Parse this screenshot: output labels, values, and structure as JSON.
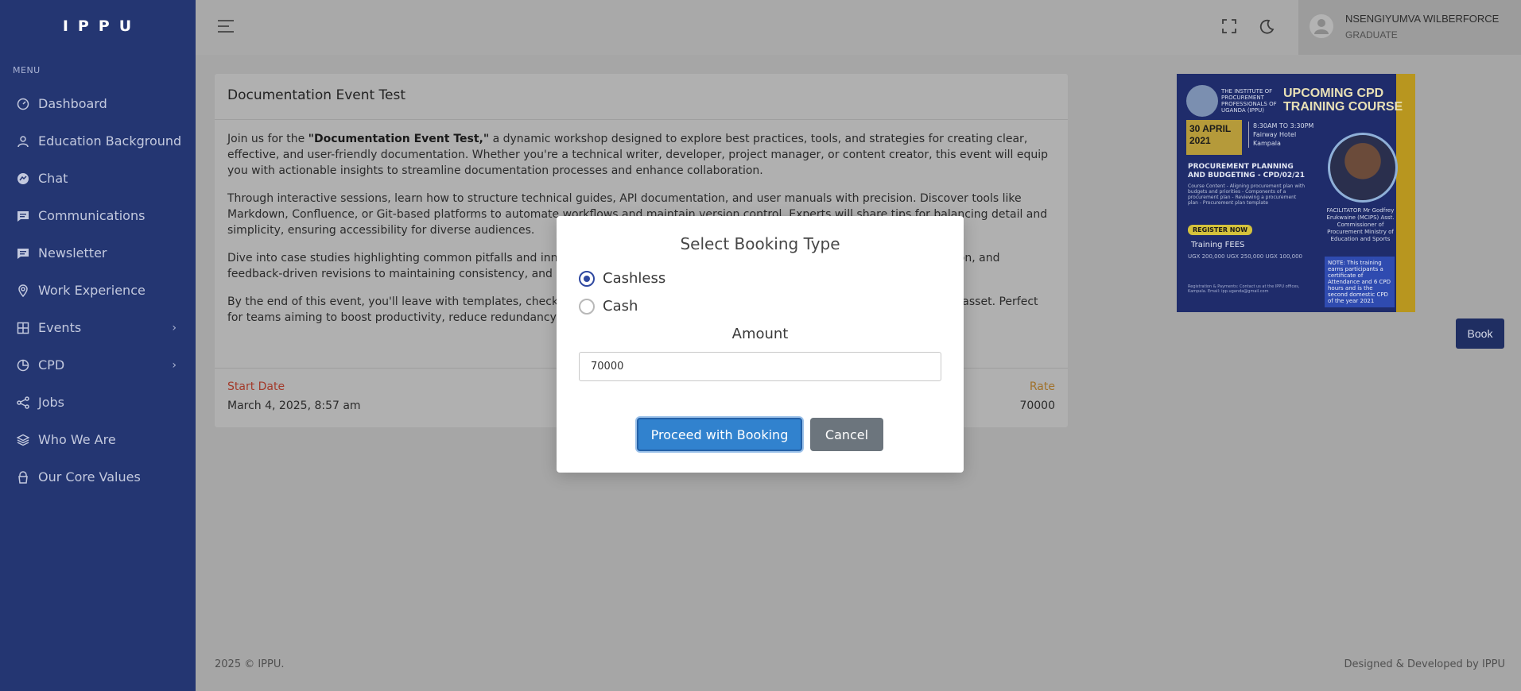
{
  "app": {
    "logo": "IPPU"
  },
  "sidebar": {
    "menu_title": "MENU",
    "items": [
      {
        "label": "Dashboard",
        "icon": "dashboard-icon"
      },
      {
        "label": "Education Background",
        "icon": "user-icon"
      },
      {
        "label": "Chat",
        "icon": "messenger-icon"
      },
      {
        "label": "Communications",
        "icon": "message-icon"
      },
      {
        "label": "Newsletter",
        "icon": "message-icon"
      },
      {
        "label": "Work Experience",
        "icon": "location-icon"
      },
      {
        "label": "Events",
        "icon": "grid-icon",
        "has_submenu": true
      },
      {
        "label": "CPD",
        "icon": "pie-chart-icon",
        "has_submenu": true
      },
      {
        "label": "Jobs",
        "icon": "share-icon"
      },
      {
        "label": "Who We Are",
        "icon": "layers-icon"
      },
      {
        "label": "Our Core Values",
        "icon": "lock-icon"
      }
    ]
  },
  "topbar": {
    "user_name": "NSENGIYUMVA WILBERFORCE",
    "user_role": "GRADUATE"
  },
  "event": {
    "title": "Documentation Event Test",
    "p1_before": "Join us for the ",
    "p1_bold": "\"Documentation Event Test,\"",
    "p1_after": " a dynamic workshop designed to explore best practices, tools, and strategies for creating clear, effective, and user-friendly documentation. Whether you're a technical writer, developer, project manager, or content creator, this event will equip you with actionable insights to streamline documentation processes and enhance collaboration.",
    "p2": "Through interactive sessions, learn how to structure technical guides, API documentation, and user manuals with precision. Discover tools like Markdown, Confluence, or Git-based platforms to automate workflows and maintain version control. Experts will share tips for balancing detail and simplicity, ensuring accessibility for diverse audiences.",
    "p3": "Dive into case studies highlighting common pitfalls and innovative solutions, from writing concise instructions, visual aids integration, and feedback-driven revisions to maintaining consistency, and scaling documentation for growing projects.",
    "p4": "By the end of this event, you'll leave with templates, checklists, and strategies to turn documentation from a chore into a strategic asset. Perfect for teams aiming to boost productivity, reduce redundancy, and deliver polished results.",
    "start_date_label": "Start Date",
    "start_date_value": "March 4, 2025, 8:57 am",
    "rate_label": "Rate",
    "rate_value": "70000"
  },
  "poster": {
    "institute": "THE INSTITUTE OF PROCUREMENT PROFESSIONALS OF UGANDA (IPPU)",
    "headline_1": "UPCOMING CPD",
    "headline_2": "TRAINING COURSE",
    "date_day": "30 APRIL",
    "date_year": "2021",
    "time": "8:30AM TO 3:30PM",
    "venue_1": "Fairway Hotel",
    "venue_2": "Kampala",
    "course_title": "PROCUREMENT PLANNING AND BUDGETING - CPD/02/21",
    "course_content": "Course Content - Aligning procurement plan with budgets and priorities - Components of a procurement plan - Reviewing a procurement plan - Procurement plan template",
    "facilitator": "FACILITATOR Mr Godfrey Erukwaine (MCIPS) Asst. Commissioner of Procurement Ministry of Education and Sports",
    "register": "REGISTER NOW",
    "fees_title": "Training FEES",
    "fees_values": "UGX 200,000   UGX 250,000   UGX 100,000",
    "note": "NOTE: This training earns participants a certificate of Attendance and 6 CPD hours and is the second domestic CPD of the year 2021",
    "contact": "Registration & Payments: Contact us at the IPPU offices, Kampala. Email: ipp.uganda@gmail.com"
  },
  "actions": {
    "book": "Book"
  },
  "footer": {
    "copyright": "2025 © IPPU.",
    "credit": "Designed & Developed by IPPU"
  },
  "modal": {
    "title": "Select Booking Type",
    "options": [
      {
        "label": "Cashless",
        "checked": true
      },
      {
        "label": "Cash",
        "checked": false
      }
    ],
    "amount_label": "Amount",
    "amount_value": "70000",
    "proceed_label": "Proceed with Booking",
    "cancel_label": "Cancel"
  },
  "colors": {
    "sidebar_bg": "#243672",
    "primary_button": "#3182ce",
    "cancel_button": "#6c757d",
    "radio_checked": "#2f48a0"
  }
}
